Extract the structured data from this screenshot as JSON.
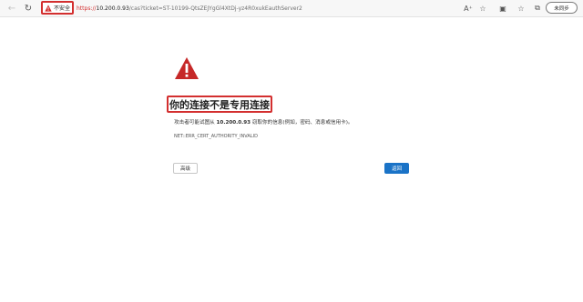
{
  "browser": {
    "security_label": "不安全",
    "url_scheme": "https://",
    "url_host": "10.200.0.93",
    "url_path": "/cas?ticket=ST-10199-QtsZEJYgGl4XtDj-yz4R0xukEauthServer2",
    "profile_label": "未同步",
    "icons": {
      "back": "back-arrow-icon",
      "refresh": "refresh-icon",
      "read_aloud": "read-aloud-icon",
      "favorite": "favorite-star-icon",
      "extensions": "extensions-icon",
      "favorites_bar": "favorites-collection-icon",
      "collections": "collections-icon"
    }
  },
  "error_page": {
    "title": "你的连接不是专用连接",
    "desc_prefix": "攻击者可能试图从 ",
    "desc_host": "10.200.0.93",
    "desc_suffix": " 窃取你的信息(例如，密码、消息或信用卡)。",
    "error_code": "NET::ERR_CERT_AUTHORITY_INVALID",
    "advanced_label": "高级",
    "back_label": "返回"
  },
  "colors": {
    "warning_red": "#d32f2f",
    "button_blue": "#1a73c7"
  }
}
